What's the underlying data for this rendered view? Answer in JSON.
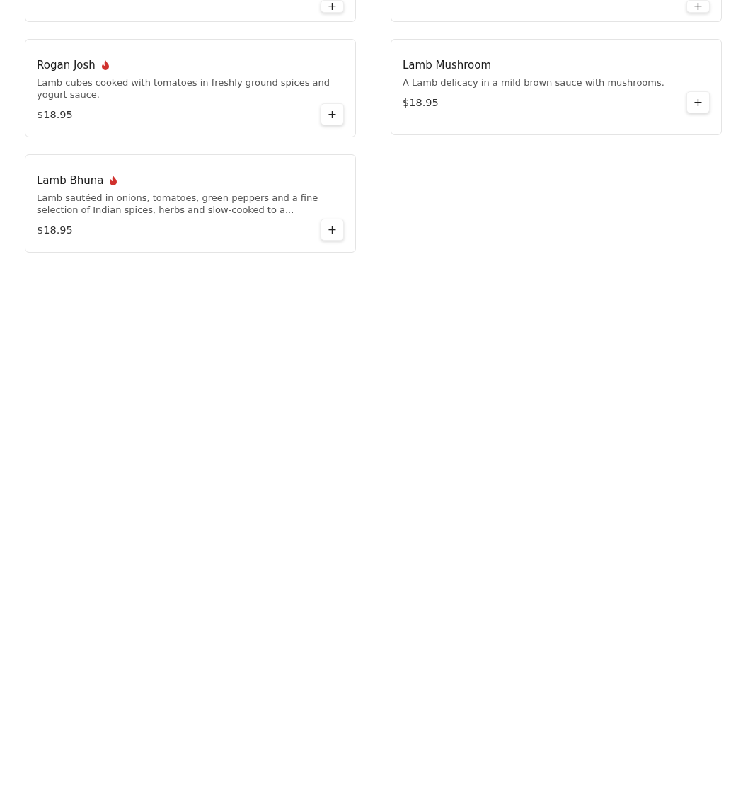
{
  "partial_cards": [
    {
      "add_label": "+"
    },
    {
      "add_label": "+"
    }
  ],
  "items": [
    {
      "name": "Rogan Josh",
      "spicy": true,
      "description": "Lamb cubes cooked with tomatoes in freshly ground spices and yogurt sauce.",
      "price": "$18.95",
      "add_label": "+"
    },
    {
      "name": "Lamb Mushroom",
      "spicy": false,
      "description": "A Lamb delicacy in a mild brown sauce with mushrooms.",
      "price": "$18.95",
      "add_label": "+"
    },
    {
      "name": "Lamb Bhuna",
      "spicy": true,
      "description": "Lamb sautéed in onions, tomatoes, green peppers and a fine selection of Indian spices, herbs and slow-cooked to a...",
      "price": "$18.95",
      "add_label": "+"
    }
  ]
}
